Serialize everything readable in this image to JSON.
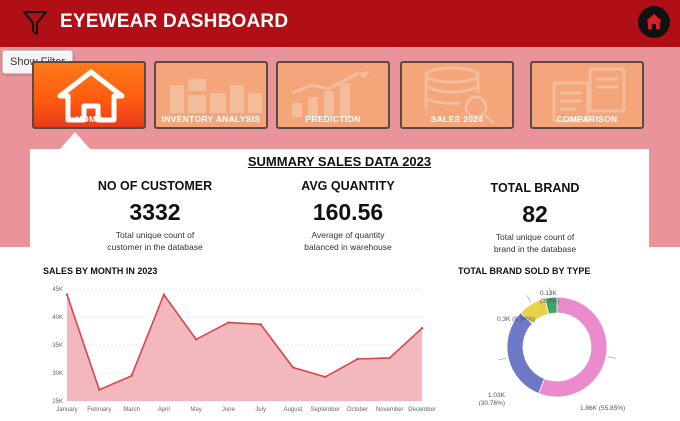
{
  "header": {
    "title": "EYEWEAR DASHBOARD",
    "filter_tooltip": "Show Filter"
  },
  "nav": {
    "tiles": [
      {
        "label": "HOME",
        "active": true
      },
      {
        "label": "INVENTORY ANALYSIS",
        "active": false
      },
      {
        "label": "PREDICTION",
        "active": false
      },
      {
        "label": "SALES 2024",
        "active": false
      },
      {
        "label": "COMPARISON",
        "active": false
      }
    ]
  },
  "summary": {
    "title": "SUMMARY SALES DATA 2023",
    "kpis": [
      {
        "title": "NO OF CUSTOMER",
        "value": "3332",
        "desc1": "Total unique count of",
        "desc2": "customer in the database"
      },
      {
        "title": "AVG QUANTITY",
        "value": "160.56",
        "desc1": "Average of quantity",
        "desc2": "balanced in warehouse"
      },
      {
        "title": "TOTAL BRAND",
        "value": "82",
        "desc1": "Total unique count of",
        "desc2": "brand in the database"
      }
    ]
  },
  "colors": {
    "header_red": "#b01015",
    "band_pink": "#e8949a",
    "line_red": "#d9454e",
    "area_pink": "#f2b8be",
    "donut_pink": "#e98bcc",
    "donut_blue": "#6e78c8",
    "donut_yellow": "#e8d24a",
    "donut_green": "#3fa661"
  },
  "chart_data": [
    {
      "type": "area",
      "title": "SALES BY MONTH IN 2023",
      "categories": [
        "January",
        "February",
        "March",
        "April",
        "May",
        "June",
        "July",
        "August",
        "September",
        "October",
        "November",
        "December"
      ],
      "values": [
        44000,
        27000,
        29500,
        44000,
        36000,
        39000,
        38700,
        31000,
        29300,
        32500,
        32700,
        38000
      ],
      "y_ticks": [
        "25K",
        "30K",
        "35K",
        "40K",
        "45K"
      ],
      "ylim": [
        25000,
        45000
      ],
      "grid": true
    },
    {
      "type": "pie",
      "title": "TOTAL BRAND SOLD BY TYPE",
      "slices": [
        {
          "value": 1.86,
          "label1": "1.86K (55.85%)",
          "label2": "",
          "color": "#e98bcc"
        },
        {
          "value": 1.03,
          "label1": "1.03K",
          "label2": "(30.76%)",
          "color": "#6e78c8"
        },
        {
          "value": 0.3,
          "label1": "0.3K (8.94%)",
          "label2": "",
          "color": "#e8d24a"
        },
        {
          "value": 0.13,
          "label1": "0.13K",
          "label2": "(3.9%)",
          "color": "#3fa661"
        }
      ]
    }
  ]
}
